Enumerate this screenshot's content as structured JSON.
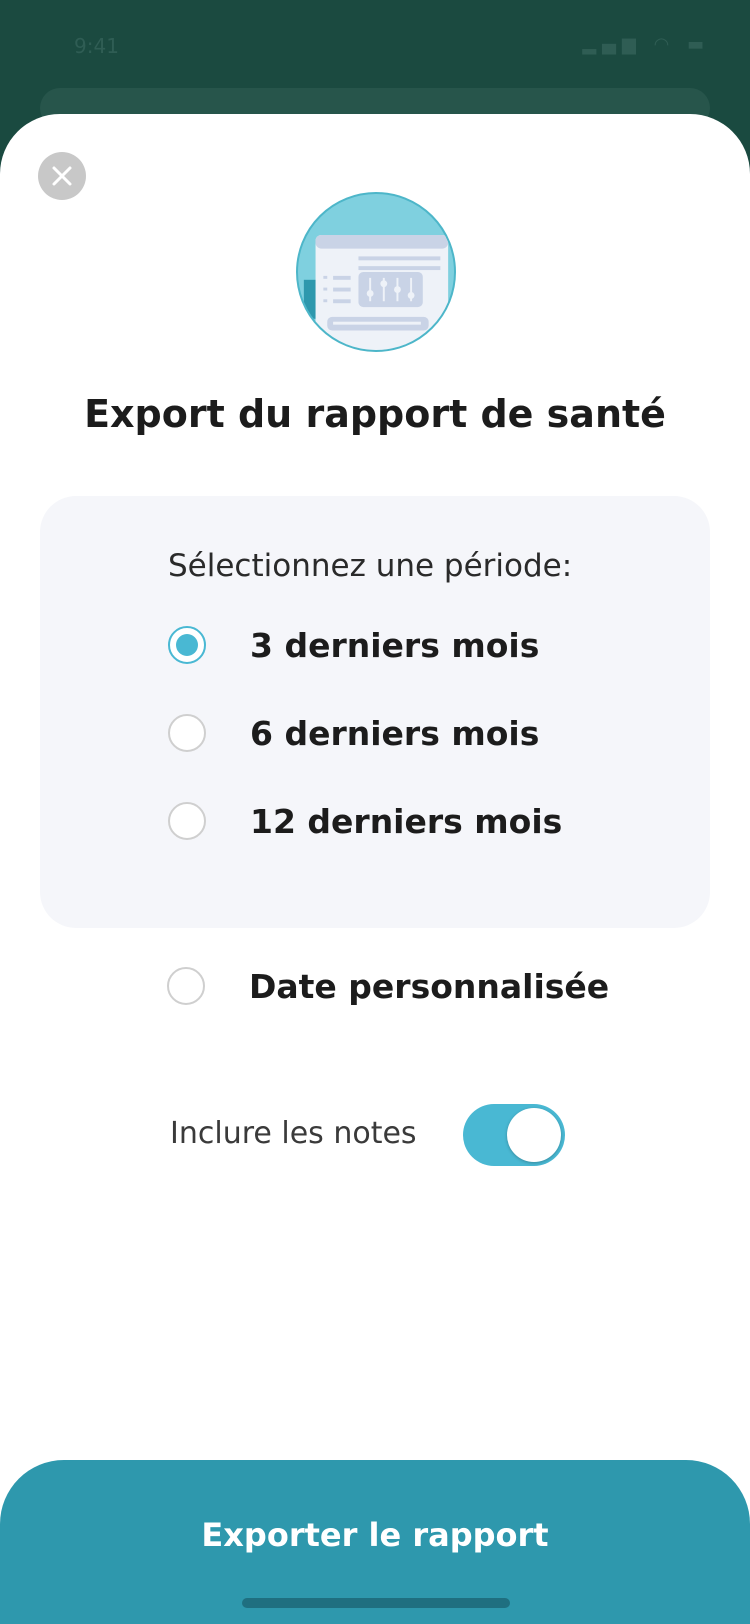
{
  "status_bar": {
    "time": "9:41"
  },
  "dialog": {
    "title": "Export du rapport de santé",
    "period_label": "Sélectionnez une période:",
    "options": [
      {
        "label": "3 derniers mois",
        "selected": true
      },
      {
        "label": "6 derniers mois",
        "selected": false
      },
      {
        "label": "12 derniers mois",
        "selected": false
      }
    ],
    "custom_option": {
      "label": "Date personnalisée",
      "selected": false
    },
    "notes_toggle": {
      "label": "Inclure les notes",
      "on": true
    },
    "export_button": {
      "label": "Exporter le rapport"
    }
  },
  "colors": {
    "accent": "#49b8d3",
    "button": "#2e98ad",
    "card": "#f5f6fa"
  },
  "icons": {
    "close": "close-icon",
    "illustration": "report-settings-illustration"
  }
}
